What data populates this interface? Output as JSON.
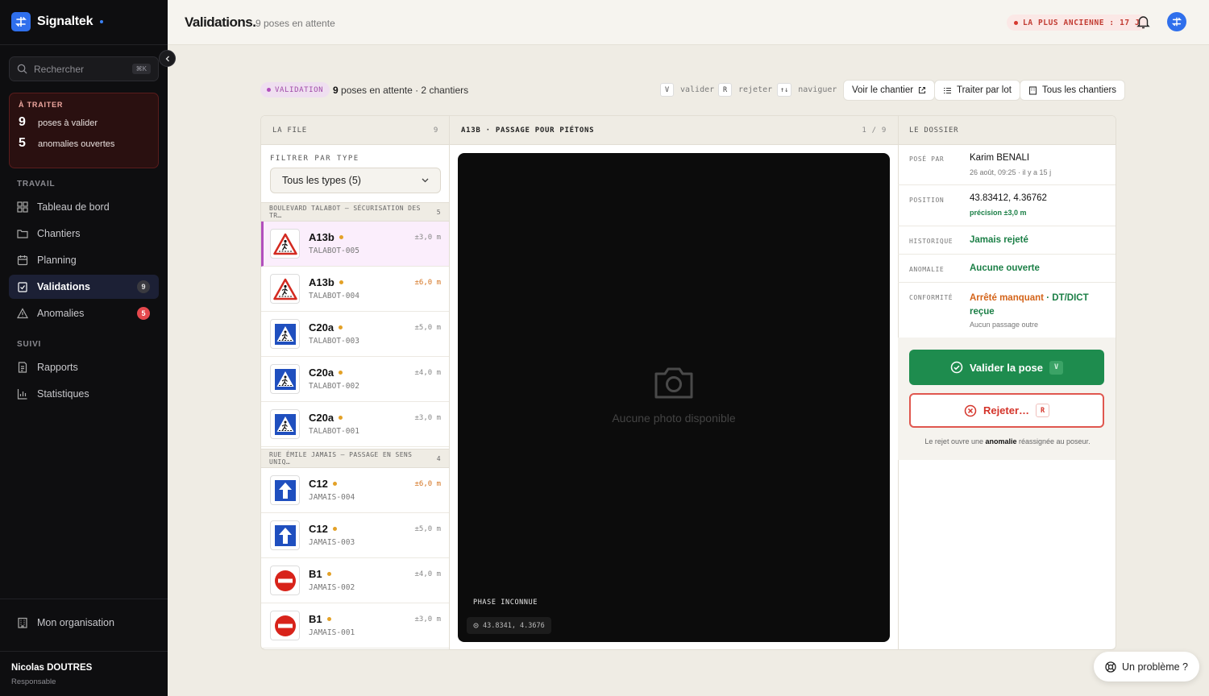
{
  "app": {
    "name": "Signaltek"
  },
  "sidebar": {
    "search_placeholder": "Rechercher",
    "search_shortcut": "⌘K",
    "todo": {
      "title": "À TRAITER",
      "rows": [
        {
          "count": "9",
          "label": "poses à valider"
        },
        {
          "count": "5",
          "label": "anomalies ouvertes"
        }
      ]
    },
    "sections": {
      "work": "TRAVAIL",
      "follow": "SUIVI"
    },
    "items": [
      {
        "label": "Tableau de bord"
      },
      {
        "label": "Chantiers"
      },
      {
        "label": "Planning"
      },
      {
        "label": "Validations",
        "badge": "9"
      },
      {
        "label": "Anomalies",
        "badge": "5"
      },
      {
        "label": "Rapports"
      },
      {
        "label": "Statistiques"
      }
    ],
    "org": "Mon organisation",
    "user": {
      "name": "Nicolas DOUTRES",
      "role": "Responsable"
    }
  },
  "header": {
    "title": "Validations.",
    "subtitle": "9 poses en attente",
    "oldest": "LA PLUS ANCIENNE : 17 J"
  },
  "toolbar": {
    "tag": "VALIDATION",
    "summary_count": "9",
    "summary_rest": "poses en attente · 2 chantiers",
    "shortcuts": [
      {
        "key": "V",
        "label": "valider"
      },
      {
        "key": "R",
        "label": "rejeter"
      },
      {
        "key": "↑↓",
        "label": "naviguer"
      }
    ],
    "buttons": {
      "site": "Voir le chantier",
      "batch": "Traiter par lot",
      "all": "Tous les chantiers"
    }
  },
  "queue": {
    "title": "LA FILE",
    "count": "9",
    "filter_label": "FILTRER PAR TYPE",
    "filter_value": "Tous les types (5)",
    "groups": [
      {
        "name": "BOULEVARD TALABOT — SÉCURISATION DES TR…",
        "count": "5",
        "items": [
          {
            "code": "A13b",
            "ref": "TALABOT-005",
            "precision": "±3,0 m",
            "warn": false,
            "icon": "pedestrian-warning-icon"
          },
          {
            "code": "A13b",
            "ref": "TALABOT-004",
            "precision": "±6,0 m",
            "warn": true,
            "icon": "pedestrian-warning-icon"
          },
          {
            "code": "C20a",
            "ref": "TALABOT-003",
            "precision": "±5,0 m",
            "warn": false,
            "icon": "pedestrian-crossing-icon"
          },
          {
            "code": "C20a",
            "ref": "TALABOT-002",
            "precision": "±4,0 m",
            "warn": false,
            "icon": "pedestrian-crossing-icon"
          },
          {
            "code": "C20a",
            "ref": "TALABOT-001",
            "precision": "±3,0 m",
            "warn": false,
            "icon": "pedestrian-crossing-icon"
          }
        ]
      },
      {
        "name": "RUE ÉMILE JAMAIS — PASSAGE EN SENS UNIQ…",
        "count": "4",
        "items": [
          {
            "code": "C12",
            "ref": "JAMAIS-004",
            "precision": "±6,0 m",
            "warn": true,
            "icon": "one-way-icon"
          },
          {
            "code": "C12",
            "ref": "JAMAIS-003",
            "precision": "±5,0 m",
            "warn": false,
            "icon": "one-way-icon"
          },
          {
            "code": "B1",
            "ref": "JAMAIS-002",
            "precision": "±4,0 m",
            "warn": false,
            "icon": "no-entry-icon"
          },
          {
            "code": "B1",
            "ref": "JAMAIS-001",
            "precision": "±3,0 m",
            "warn": false,
            "icon": "no-entry-icon"
          }
        ]
      }
    ]
  },
  "photo": {
    "title": "A13B · PASSAGE POUR PIÉTONS",
    "position": "1 / 9",
    "empty": "Aucune photo disponible",
    "phase": "PHASE INCONNUE",
    "coords": "43.8341, 4.3676"
  },
  "dossier": {
    "title": "LE DOSSIER",
    "posed_by_label": "POSÉ PAR",
    "posed_by": "Karim BENALI",
    "posed_at": "26 août, 09:25 · il y a 15 j",
    "position_label": "POSITION",
    "position": "43.83412, 4.36762",
    "precision": "précision ±3,0 m",
    "history_label": "HISTORIQUE",
    "history": "Jamais rejeté",
    "anomaly_label": "ANOMALIE",
    "anomaly": "Aucune ouverte",
    "compliance_label": "CONFORMITÉ",
    "compliance_warn": "Arrêté manquant",
    "compliance_sep": " · ",
    "compliance_ok": "DT/DICT reçue",
    "compliance_sub": "Aucun passage outre",
    "validate": "Valider la pose",
    "validate_key": "V",
    "reject": "Rejeter…",
    "reject_key": "R",
    "reject_note_pre": "Le rejet ouvre une ",
    "reject_note_bold": "anomalie",
    "reject_note_post": " réassignée au poseur."
  },
  "help": "Un problème ?"
}
